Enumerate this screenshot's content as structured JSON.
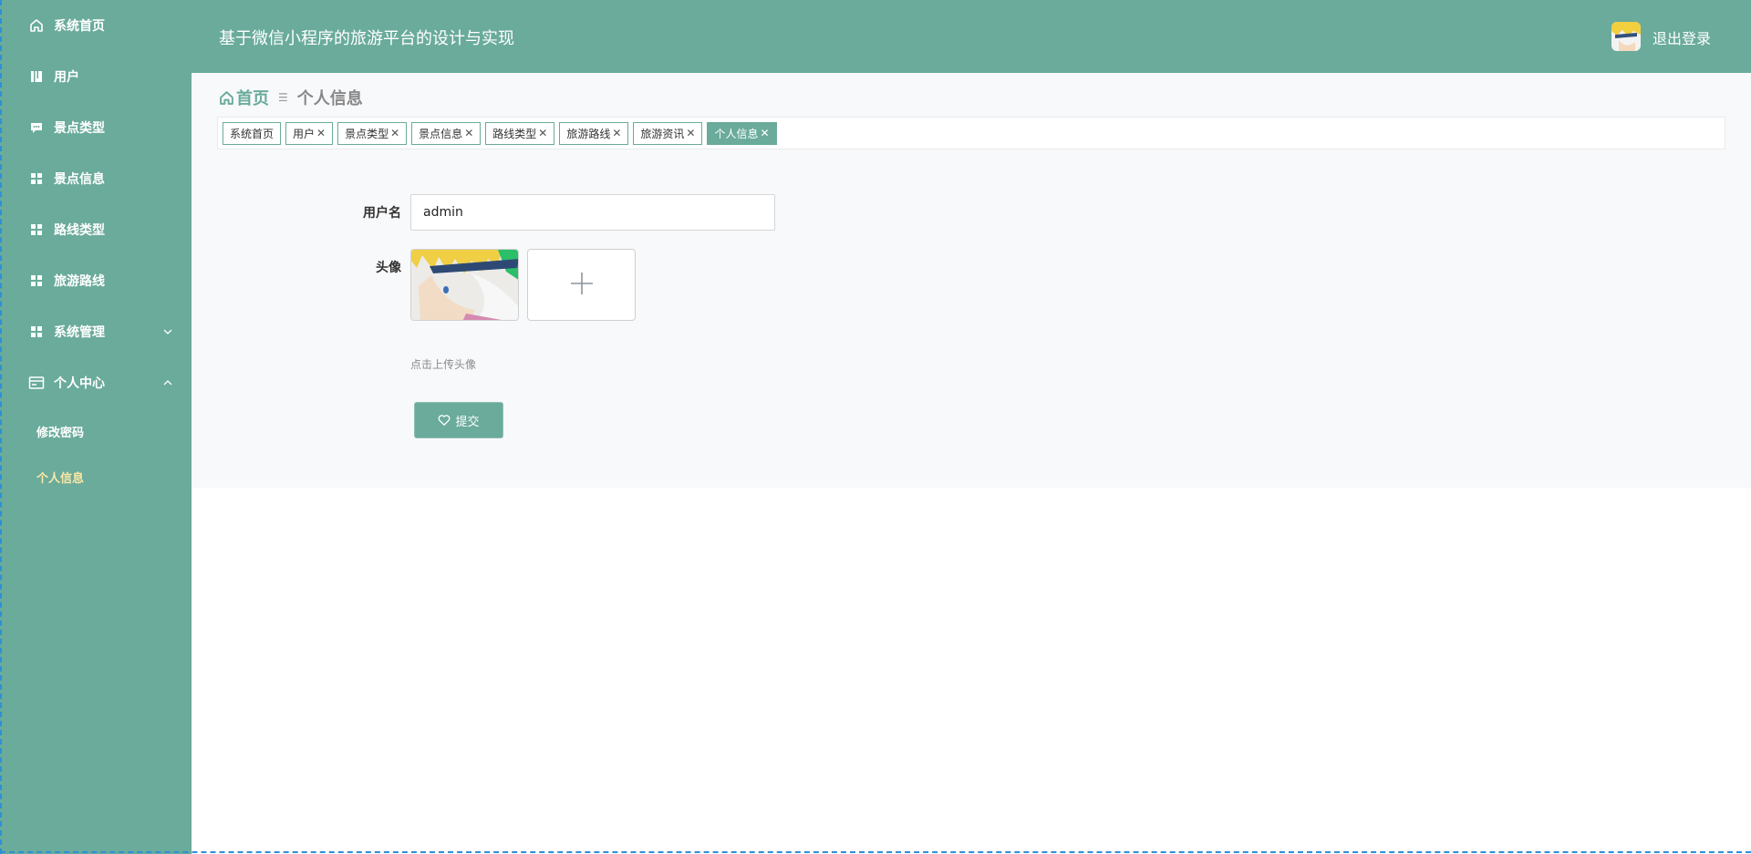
{
  "app": {
    "title": "基于微信小程序的旅游平台的设计与实现",
    "logout_label": "退出登录"
  },
  "sidebar": {
    "items": [
      {
        "label": "系统首页",
        "icon": "home-icon"
      },
      {
        "label": "用户",
        "icon": "book-icon"
      },
      {
        "label": "景点类型",
        "icon": "chat-icon"
      },
      {
        "label": "景点信息",
        "icon": "grid-icon"
      },
      {
        "label": "路线类型",
        "icon": "grid-icon"
      },
      {
        "label": "旅游路线",
        "icon": "grid-icon"
      },
      {
        "label": "系统管理",
        "icon": "grid-icon",
        "expanded": false
      },
      {
        "label": "个人中心",
        "icon": "card-icon",
        "expanded": true
      }
    ],
    "sub_items": [
      {
        "label": "修改密码",
        "active": false
      },
      {
        "label": "个人信息",
        "active": true
      }
    ]
  },
  "breadcrumb": {
    "home": "首页",
    "current": "个人信息"
  },
  "tags": [
    {
      "label": "系统首页",
      "closable": false
    },
    {
      "label": "用户",
      "closable": true
    },
    {
      "label": "景点类型",
      "closable": true
    },
    {
      "label": "景点信息",
      "closable": true
    },
    {
      "label": "路线类型",
      "closable": true
    },
    {
      "label": "旅游路线",
      "closable": true
    },
    {
      "label": "旅游资讯",
      "closable": true
    },
    {
      "label": "个人信息",
      "closable": true,
      "active": true
    }
  ],
  "form": {
    "username_label": "用户名",
    "username_value": "admin",
    "avatar_label": "头像",
    "upload_hint": "点击上传头像",
    "submit_label": "提交"
  },
  "colors": {
    "primary": "#6aab9b",
    "panel_bg": "#f8f9fb",
    "active_sub": "#fbe7a6"
  }
}
